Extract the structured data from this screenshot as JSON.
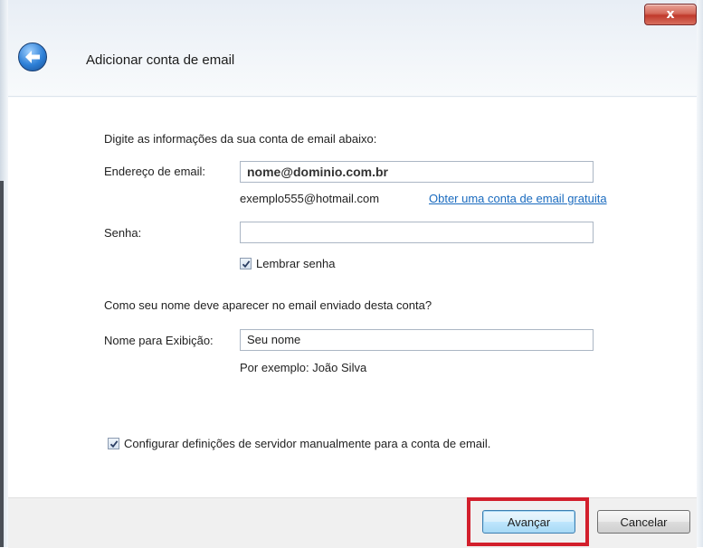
{
  "window": {
    "title": "Adicionar conta de email",
    "close_label": "x"
  },
  "form": {
    "intro": "Digite as informações da sua conta de email abaixo:",
    "email_label": "Endereço de email:",
    "email_value": "nome@dominio.com.br",
    "email_example": "exemplo555@hotmail.com",
    "free_account_link": "Obter uma conta de email gratuita",
    "password_label": "Senha:",
    "password_value": "",
    "remember_password": {
      "label": "Lembrar senha",
      "checked": true
    },
    "display_question": "Como seu nome deve aparecer no email enviado desta conta?",
    "display_name_label": "Nome para Exibição:",
    "display_name_value": "Seu nome",
    "display_name_example": "Por exemplo: João Silva",
    "manual_config": {
      "label": "Configurar definições de servidor manualmente para a conta de email.",
      "checked": true
    }
  },
  "footer": {
    "next_label": "Avançar",
    "cancel_label": "Cancelar"
  },
  "colors": {
    "highlight": "#d21f2c",
    "link": "#1a6bbf"
  }
}
